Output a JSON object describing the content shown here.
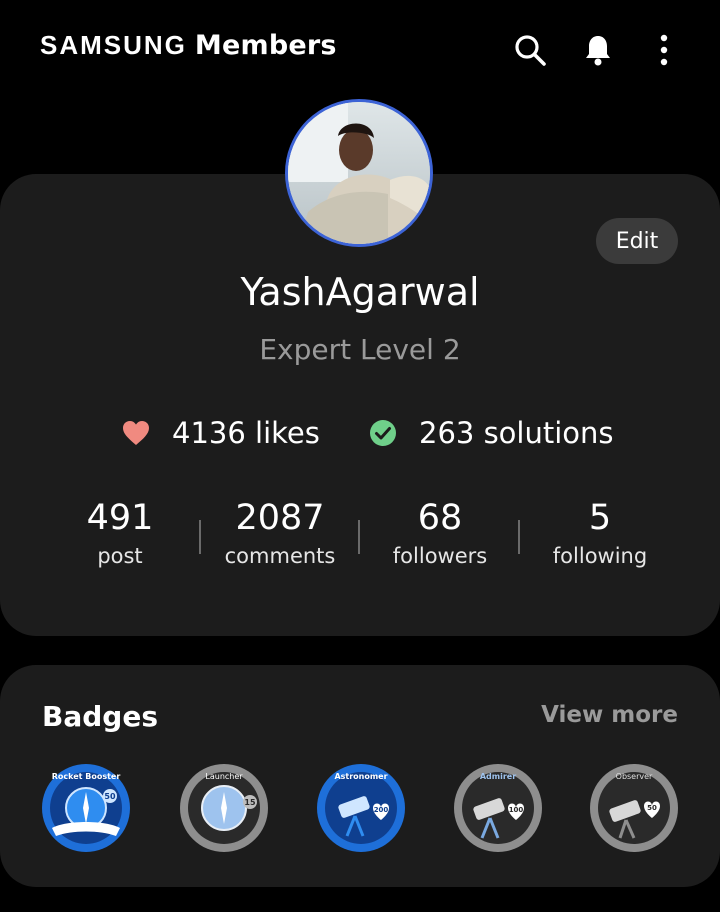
{
  "header": {
    "brand_samsung": "SAMSUNG",
    "brand_members": "Members",
    "icons": [
      "search-icon",
      "bell-icon",
      "more-vertical-icon"
    ]
  },
  "profile": {
    "edit_label": "Edit",
    "username": "YashAgarwal",
    "level": "Expert Level 2",
    "likes": "4136 likes",
    "solutions": "263 solutions",
    "counts": [
      {
        "value": "491",
        "label": "post"
      },
      {
        "value": "2087",
        "label": "comments"
      },
      {
        "value": "68",
        "label": "followers"
      },
      {
        "value": "5",
        "label": "following"
      }
    ]
  },
  "badges": {
    "title": "Badges",
    "view_more": "View more",
    "items": [
      {
        "name": "Rocket Booster",
        "value": "50",
        "style": "blue"
      },
      {
        "name": "Launcher",
        "value": "15",
        "style": "gray"
      },
      {
        "name": "Astronomer",
        "value": "200",
        "style": "blue"
      },
      {
        "name": "Admirer",
        "value": "100",
        "style": "gray"
      },
      {
        "name": "Observer",
        "value": "50",
        "style": "gray"
      }
    ]
  },
  "colors": {
    "background": "#000000",
    "card": "#1c1c1c",
    "heart": "#f08a80",
    "check": "#6fcf8a",
    "muted_text": "#9a9a9a",
    "avatar_ring": "#3c63d6",
    "badge_blue": "#1e6fd9"
  }
}
